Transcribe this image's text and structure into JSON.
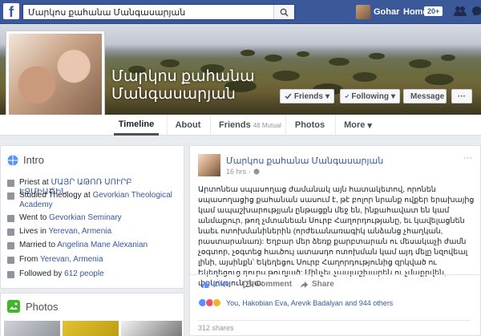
{
  "topbar": {
    "logo": "f",
    "search_value": "Մարկոս քահանա Մանգասարյան",
    "user_name": "Gohar",
    "home_label": "Home",
    "home_badge": "20+"
  },
  "profile": {
    "name": "Մարկոս քահանա Մանգասարյան",
    "friends_button": "Friends",
    "following_button": "Following",
    "message_button": "Message",
    "more_button": "···"
  },
  "tabs": {
    "timeline": "Timeline",
    "about": "About",
    "friends": "Friends",
    "friends_count": "48 Mutual",
    "photos": "Photos",
    "more": "More"
  },
  "intro": {
    "title": "Intro",
    "items": [
      {
        "icon": "briefcase-icon",
        "prefix": "Priest at ",
        "link": "ՄԱՅՐ ԱԹՈՌ ՍՈՒՐԲ ԷՋՄԻԱԾԻՆ",
        "suffix": ""
      },
      {
        "icon": "graduation-cap-icon",
        "prefix": "Studied Theology at ",
        "link": "Gevorkian Theological Academy",
        "suffix": ""
      },
      {
        "icon": "graduation-cap-icon",
        "prefix": "Went to ",
        "link": "Gevorkian Seminary",
        "suffix": ""
      },
      {
        "icon": "home-icon",
        "prefix": "Lives in ",
        "link": "Yerevan, Armenia",
        "suffix": ""
      },
      {
        "icon": "heart-icon",
        "prefix": "Married to ",
        "link": "Angelina Mane Alexanian",
        "suffix": ""
      },
      {
        "icon": "location-pin-icon",
        "prefix": "From ",
        "link": "Yerevan, Armenia",
        "suffix": ""
      },
      {
        "icon": "rss-icon",
        "prefix": "Followed by ",
        "link": "612 people",
        "suffix": ""
      }
    ]
  },
  "photos": {
    "title": "Photos"
  },
  "post": {
    "author": "Մարկոս քահանա Մանգասարյան",
    "time": "16 hrs",
    "options": "···",
    "text": "Արտոնեա սպասողաց ժամանակ այն հատակետով, որոնեն սպասողացից քահանան սասում է, թէ բոլոր նրանք ովքեր երախայից կամ ապաշխարությյան ընթացքն մեջ են, ինքահավատ են կամ անմաքուր, թող չմտանեան Սուրբ Հաղորդությանը, եւ կավելացնեն նաեւ ոտոխմանիներին (որժեւանառագիկ անձանց չհաղկան, րաստարանառ): Եղբար մեր ձեռք քարբտարան ու մեսակաչի ժամն չօգտոր, չօգտեց հաւծույ ատասդո ոտոխման կամ այդ մելը նզովեալ լինի, այսինքն՝ Եկեղեցու Սուրբ Հաղորդությունից զրկված ու Եկեղեցուց դուրս թուղյած: Մինչեւ չապաշխարեն ու չմաքրվեն, փրկություն չկա:",
    "like_label": "Like",
    "comment_label": "Comment",
    "share_label": "Share",
    "reactions_text": "You, Hakobian Eva, Arevik Badalyan and 944 others",
    "shares_text": "312 shares"
  },
  "colors": {
    "brand": "#3b5998",
    "link": "#365899",
    "like_blue": "#5890ff"
  }
}
